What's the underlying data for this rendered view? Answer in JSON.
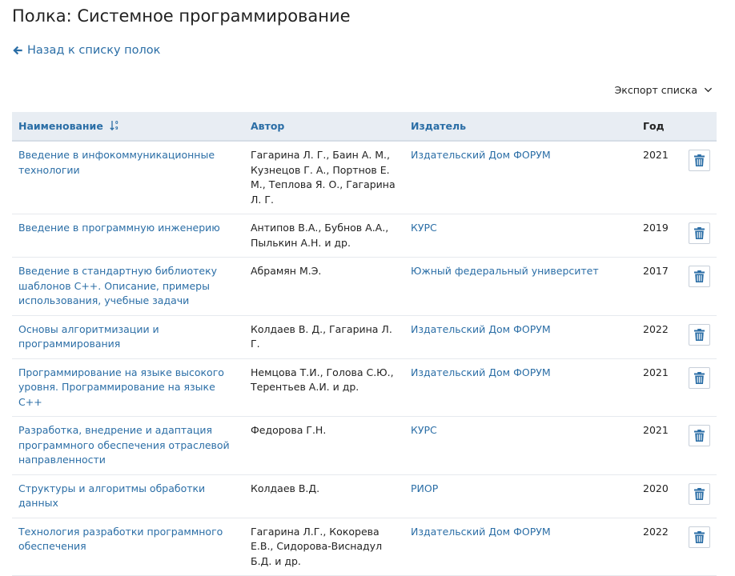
{
  "page": {
    "title": "Полка: Системное программирование",
    "back_link": "Назад к списку полок",
    "export_label": "Экспорт списка"
  },
  "table": {
    "headers": {
      "title": "Наименование",
      "author": "Автор",
      "publisher": "Издатель",
      "year": "Год"
    },
    "rows": [
      {
        "title": "Введение в инфокоммуникационные технологии",
        "author": "Гагарина Л. Г., Баин А. М., Кузнецов Г. А., Портнов Е. М., Теплова Я. О., Гагарина Л. Г.",
        "publisher": "Издательский Дом ФОРУМ",
        "year": "2021"
      },
      {
        "title": "Введение в программную инженерию",
        "author": "Антипов В.А., Бубнов А.А., Пылькин А.Н. и др.",
        "publisher": "КУРС",
        "year": "2019"
      },
      {
        "title": "Введение в стандартную библиотеку шаблонов С++. Описание, примеры использования, учебные задачи",
        "author": "Абрамян М.Э.",
        "publisher": "Южный федеральный университет",
        "year": "2017"
      },
      {
        "title": "Основы алгоритмизации и программирования",
        "author": "Колдаев В. Д., Гагарина Л. Г.",
        "publisher": "Издательский Дом ФОРУМ",
        "year": "2022"
      },
      {
        "title": "Программирование на языке высокого уровня. Программирование на языке С++",
        "author": "Немцова Т.И., Голова С.Ю., Терентьев А.И. и др.",
        "publisher": "Издательский Дом ФОРУМ",
        "year": "2021"
      },
      {
        "title": "Разработка, внедрение и адаптация программного обеспечения отраслевой направленности",
        "author": "Федорова Г.Н.",
        "publisher": "КУРС",
        "year": "2021"
      },
      {
        "title": "Структуры и алгоритмы обработки данных",
        "author": "Колдаев В.Д.",
        "publisher": "РИОР",
        "year": "2020"
      },
      {
        "title": "Технология разработки программного обеспечения",
        "author": "Гагарина Л.Г., Кокорева Е.В., Сидорова-Виснадул Б.Д. и др.",
        "publisher": "Издательский Дом ФОРУМ",
        "year": "2022"
      }
    ]
  },
  "icons": {
    "back": "arrow-left-icon",
    "export": "chevron-down-icon",
    "sort": "sort-ascending-icon",
    "delete": "trash-icon"
  },
  "colors": {
    "link": "#2b6ea6",
    "header_bg": "#e8edf3",
    "text": "#222222"
  }
}
